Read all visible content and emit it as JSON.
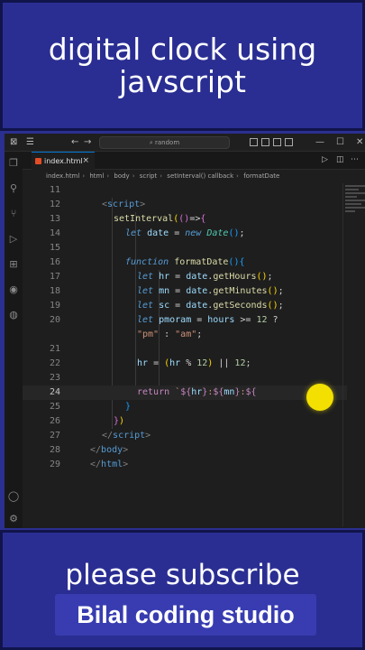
{
  "header": {
    "line1": "digital clock using",
    "line2": "javscript"
  },
  "editor": {
    "search_placeholder": "random",
    "tab": {
      "label": "index.html",
      "close": "×"
    },
    "breadcrumb": [
      "index.html",
      "html",
      "body",
      "script",
      "setInterval() callback",
      "formatDate"
    ],
    "lines": [
      {
        "n": "11",
        "indent": 0,
        "tokens": []
      },
      {
        "n": "12",
        "indent": 2,
        "tokens": [
          [
            "brk",
            "<"
          ],
          [
            "tag",
            "script"
          ],
          [
            "brk",
            ">"
          ]
        ]
      },
      {
        "n": "13",
        "indent": 4,
        "tokens": [
          [
            "fn",
            "setInterval"
          ],
          [
            "par1",
            "("
          ],
          [
            "par2",
            "()"
          ],
          [
            "op",
            "=>"
          ],
          [
            "par2",
            "{"
          ]
        ]
      },
      {
        "n": "14",
        "indent": 6,
        "tokens": [
          [
            "kw",
            "let"
          ],
          [
            "op",
            " "
          ],
          [
            "var",
            "date"
          ],
          [
            "op",
            " = "
          ],
          [
            "kw",
            "new"
          ],
          [
            "op",
            " "
          ],
          [
            "cls",
            "Date"
          ],
          [
            "par3",
            "()"
          ],
          [
            "op",
            ";"
          ]
        ]
      },
      {
        "n": "15",
        "indent": 0,
        "tokens": []
      },
      {
        "n": "16",
        "indent": 6,
        "tokens": [
          [
            "kw",
            "function"
          ],
          [
            "op",
            " "
          ],
          [
            "fn",
            "formatDate"
          ],
          [
            "par3",
            "()"
          ],
          [
            "par3",
            "{"
          ]
        ]
      },
      {
        "n": "17",
        "indent": 8,
        "tokens": [
          [
            "kw",
            "let"
          ],
          [
            "op",
            " "
          ],
          [
            "var",
            "hr"
          ],
          [
            "op",
            " = "
          ],
          [
            "var",
            "date"
          ],
          [
            "op",
            "."
          ],
          [
            "fn",
            "getHours"
          ],
          [
            "par1",
            "()"
          ],
          [
            "op",
            ";"
          ]
        ]
      },
      {
        "n": "18",
        "indent": 8,
        "tokens": [
          [
            "kw",
            "let"
          ],
          [
            "op",
            " "
          ],
          [
            "var",
            "mn"
          ],
          [
            "op",
            " = "
          ],
          [
            "var",
            "date"
          ],
          [
            "op",
            "."
          ],
          [
            "fn",
            "getMinutes"
          ],
          [
            "par1",
            "()"
          ],
          [
            "op",
            ";"
          ]
        ]
      },
      {
        "n": "19",
        "indent": 8,
        "tokens": [
          [
            "kw",
            "let"
          ],
          [
            "op",
            " "
          ],
          [
            "var",
            "sc"
          ],
          [
            "op",
            " = "
          ],
          [
            "var",
            "date"
          ],
          [
            "op",
            "."
          ],
          [
            "fn",
            "getSeconds"
          ],
          [
            "par1",
            "()"
          ],
          [
            "op",
            ";"
          ]
        ]
      },
      {
        "n": "20",
        "indent": 8,
        "tokens": [
          [
            "kw",
            "let"
          ],
          [
            "op",
            " "
          ],
          [
            "var",
            "pmoram"
          ],
          [
            "op",
            " = "
          ],
          [
            "var",
            "hours"
          ],
          [
            "op",
            " >= "
          ],
          [
            "num",
            "12"
          ],
          [
            "op",
            " ?"
          ]
        ]
      },
      {
        "n": "",
        "indent": 8,
        "tokens": [
          [
            "str",
            "\"pm\""
          ],
          [
            "op",
            " : "
          ],
          [
            "str",
            "\"am\""
          ],
          [
            "op",
            ";"
          ]
        ]
      },
      {
        "n": "21",
        "indent": 0,
        "tokens": []
      },
      {
        "n": "22",
        "indent": 8,
        "tokens": [
          [
            "var",
            "hr"
          ],
          [
            "op",
            " = "
          ],
          [
            "par1",
            "("
          ],
          [
            "var",
            "hr"
          ],
          [
            "op",
            " % "
          ],
          [
            "num",
            "12"
          ],
          [
            "par1",
            ")"
          ],
          [
            "op",
            " || "
          ],
          [
            "num",
            "12"
          ],
          [
            "op",
            ";"
          ]
        ]
      },
      {
        "n": "23",
        "indent": 0,
        "tokens": []
      },
      {
        "n": "24",
        "indent": 8,
        "tokens": [
          [
            "ret",
            "return"
          ],
          [
            "op",
            " "
          ],
          [
            "str",
            "`"
          ],
          [
            "ret",
            "${"
          ],
          [
            "var",
            "hr"
          ],
          [
            "ret",
            "}"
          ],
          [
            "str",
            ":"
          ],
          [
            "ret",
            "${"
          ],
          [
            "var",
            "mn"
          ],
          [
            "ret",
            "}"
          ],
          [
            "str",
            ":"
          ],
          [
            "ret",
            "${"
          ]
        ]
      },
      {
        "n": "25",
        "indent": 6,
        "tokens": [
          [
            "par3",
            "}"
          ]
        ]
      },
      {
        "n": "26",
        "indent": 4,
        "tokens": [
          [
            "par2",
            "}"
          ],
          [
            "par1",
            ")"
          ]
        ]
      },
      {
        "n": "27",
        "indent": 2,
        "tokens": [
          [
            "brk",
            "</"
          ],
          [
            "tag",
            "script"
          ],
          [
            "brk",
            ">"
          ]
        ]
      },
      {
        "n": "28",
        "indent": 0,
        "tokens": [
          [
            "brk",
            "</"
          ],
          [
            "tag",
            "body"
          ],
          [
            "brk",
            ">"
          ]
        ]
      },
      {
        "n": "29",
        "indent": 0,
        "tokens": [
          [
            "brk",
            "</"
          ],
          [
            "tag",
            "html"
          ],
          [
            "brk",
            ">"
          ]
        ]
      }
    ],
    "current_line": "24"
  },
  "footer": {
    "subscribe": "please subscribe",
    "brand": "Bilal coding studio"
  },
  "colors": {
    "banner": "#2a2e92",
    "editor_bg": "#1e1e1e",
    "cursor_highlight": "#ffeb00"
  }
}
